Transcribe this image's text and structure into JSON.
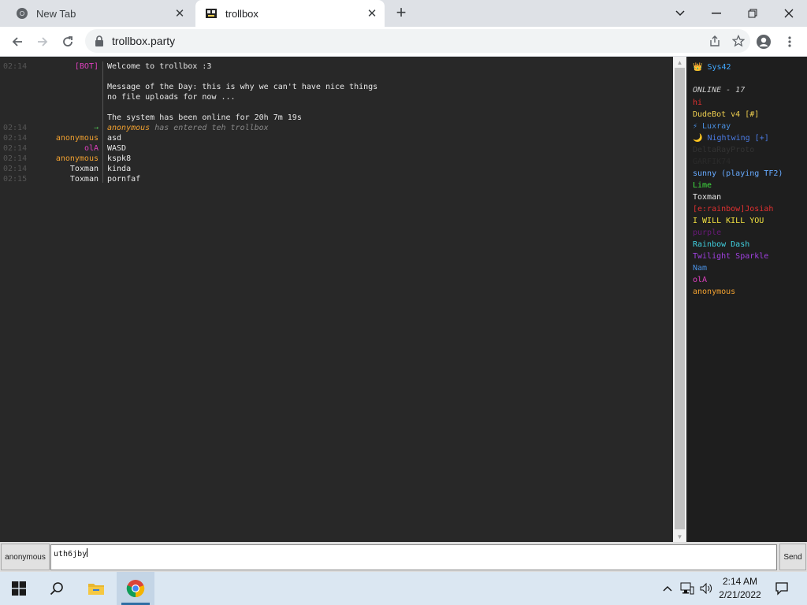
{
  "browser": {
    "tabs": [
      {
        "title": "New Tab",
        "active": false
      },
      {
        "title": "trollbox",
        "active": true
      }
    ],
    "url": "trollbox.party"
  },
  "chat": {
    "bot_nick": "[BOT]",
    "welcome": "Welcome to trollbox :3",
    "motd_line1": "Message of the Day: this is why we can't have nice things",
    "motd_line2": "no file uploads for now ...",
    "uptime": "The system has been online for 20h 7m 19s",
    "time_bot": "02:14",
    "messages": [
      {
        "time": "02:14",
        "nick": "→",
        "text": "anonymous has entered teh trollbox",
        "nick_color": "#4caf50"
      },
      {
        "time": "02:14",
        "nick": "anonymous",
        "text": "asd",
        "nick_color": "#f0a030"
      },
      {
        "time": "02:14",
        "nick": "olA",
        "text": "WASD",
        "nick_color": "#e040c0"
      },
      {
        "time": "02:14",
        "nick": "anonymous",
        "text": "kspk8",
        "nick_color": "#f0a030"
      },
      {
        "time": "02:14",
        "nick": "Toxman",
        "text": "kinda",
        "nick_color": "#e8e8e8"
      },
      {
        "time": "02:15",
        "nick": "Toxman",
        "text": "pornfaf",
        "nick_color": "#e8e8e8"
      }
    ],
    "join_user": "anonymous",
    "join_text": " has entered teh trollbox"
  },
  "sidebar": {
    "top_user": "👑 Sys42",
    "online_label": "ONLINE - 17",
    "users": [
      {
        "name": "hi",
        "color": "#e03030"
      },
      {
        "name": "DudeBot v4 [#]",
        "color": "#f0d050"
      },
      {
        "name": "⚡ Luxray",
        "color": "#4a90e2"
      },
      {
        "name": "🌙 Nightwing [+]",
        "color": "#4a7ae2"
      },
      {
        "name": "DeltaRayProto",
        "color": "#333333"
      },
      {
        "name": "GARFIK74",
        "color": "#2a2a2a"
      },
      {
        "name": "sunny (playing TF2)",
        "color": "#66aaff"
      },
      {
        "name": "Lime",
        "color": "#40e040"
      },
      {
        "name": "Toxman",
        "color": "#e8e8e8"
      },
      {
        "name": "[e:rainbow]Josiah",
        "color": "#e03030"
      },
      {
        "name": "I WILL KILL YOU",
        "color": "#f0e040"
      },
      {
        "name": "purple",
        "color": "#6a1a7a"
      },
      {
        "name": "Rainbow Dash",
        "color": "#40d0e0"
      },
      {
        "name": "Twilight Sparkle",
        "color": "#a040e0"
      },
      {
        "name": "Nam",
        "color": "#4a90e2"
      },
      {
        "name": "olA",
        "color": "#e040c0"
      },
      {
        "name": "anonymous",
        "color": "#f0a030"
      }
    ]
  },
  "input": {
    "nick_button": "anonymous",
    "value": "uth6jby",
    "send_label": "Send"
  },
  "taskbar": {
    "time": "2:14 AM",
    "date": "2/21/2022"
  }
}
